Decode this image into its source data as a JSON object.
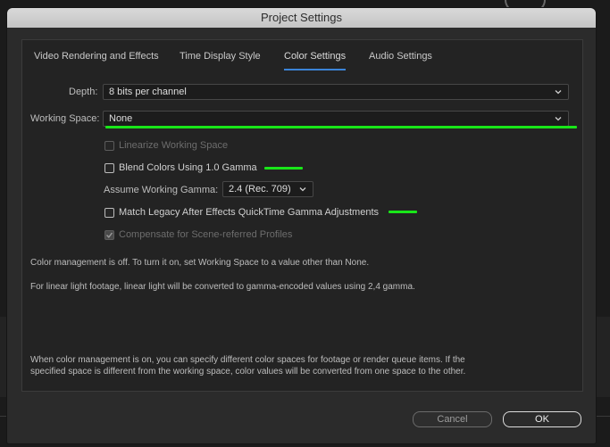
{
  "dialog": {
    "title": "Project Settings",
    "tabs": [
      {
        "label": "Video Rendering and Effects"
      },
      {
        "label": "Time Display Style"
      },
      {
        "label": "Color Settings"
      },
      {
        "label": "Audio Settings"
      }
    ],
    "active_tab": "Color Settings",
    "depth": {
      "label": "Depth:",
      "value": "8 bits per channel"
    },
    "working_space": {
      "label": "Working Space:",
      "value": "None"
    },
    "checkboxes": {
      "linearize": {
        "label": "Linearize Working Space",
        "checked": false,
        "enabled": false
      },
      "blend": {
        "label": "Blend Colors Using 1.0 Gamma",
        "checked": false,
        "enabled": true
      },
      "match_legacy": {
        "label": "Match Legacy After Effects QuickTime Gamma Adjustments",
        "checked": false,
        "enabled": true
      },
      "compensate": {
        "label": "Compensate for Scene-referred Profiles",
        "checked": true,
        "enabled": false
      }
    },
    "gamma": {
      "label": "Assume Working Gamma:",
      "value": "2.4 (Rec. 709)"
    },
    "info_lines": [
      "Color management is off. To turn it on, set Working Space to a value other than None.",
      "For linear light footage, linear light will be converted to gamma-encoded values using 2,4 gamma."
    ],
    "footnote": "When color management is on, you can specify different color spaces for footage or render queue items. If the specified space is different from the working space, color values will be converted from one space to the other.",
    "buttons": {
      "cancel": "Cancel",
      "ok": "OK"
    }
  },
  "annotation_color": "#19e619",
  "accent_color": "#3b84d8"
}
